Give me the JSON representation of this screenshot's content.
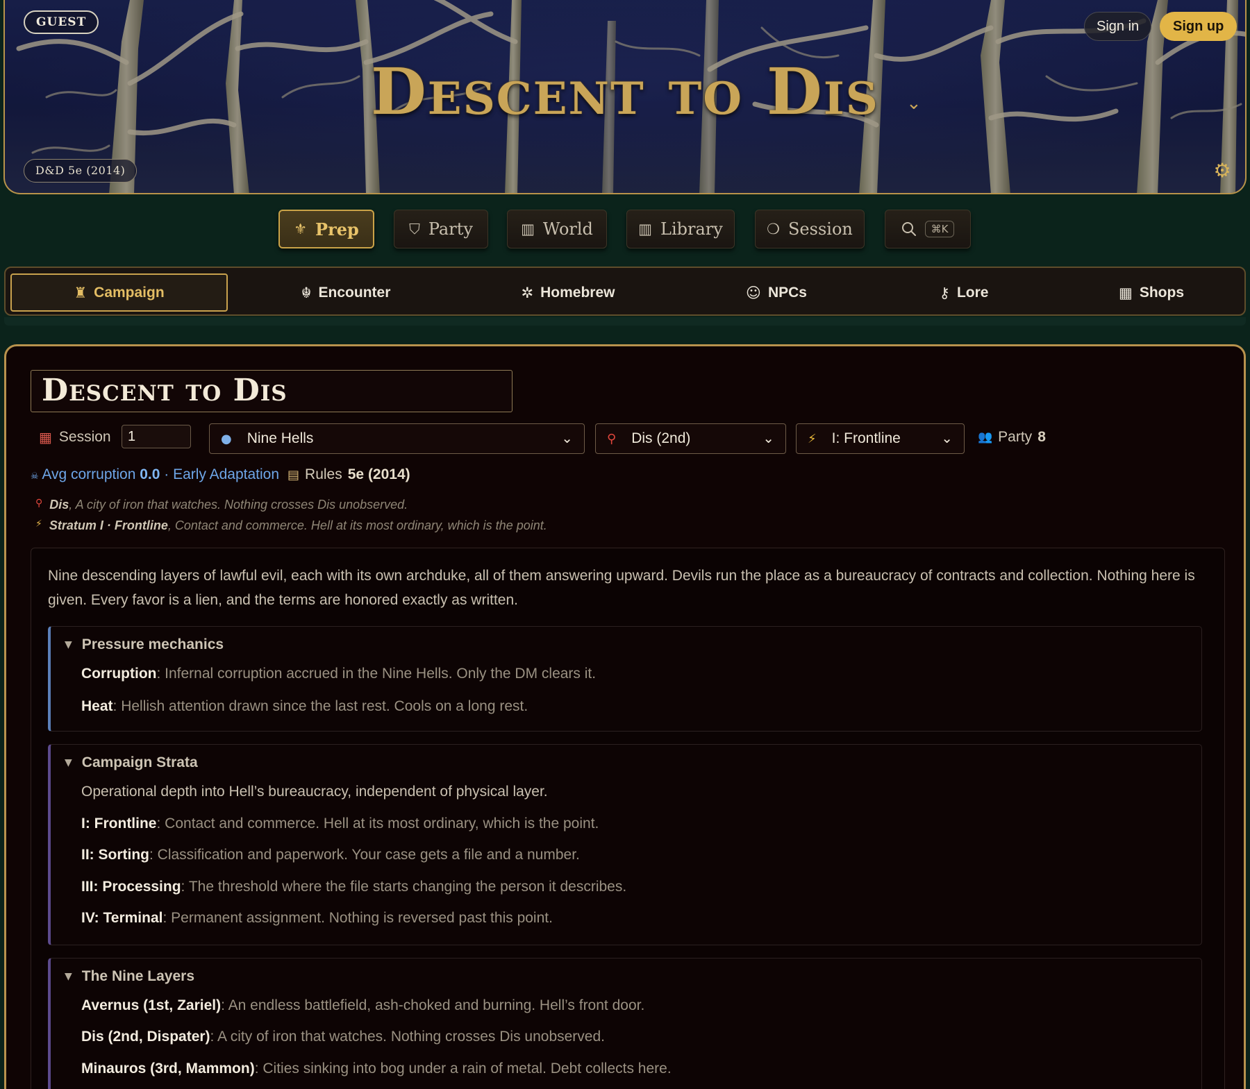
{
  "hero": {
    "guest_label": "GUEST",
    "title": "Descent to Dis",
    "system_label": "D&D 5e (2014)",
    "signin": "Sign in",
    "signup": "Sign up",
    "accent_color": "#c9a558"
  },
  "topnav": {
    "items": [
      {
        "label": "Prep",
        "icon": "helmet-icon",
        "active": true
      },
      {
        "label": "Party",
        "icon": "shield-icon"
      },
      {
        "label": "World",
        "icon": "book-icon"
      },
      {
        "label": "Library",
        "icon": "book-icon"
      },
      {
        "label": "Session",
        "icon": "chat-icon"
      }
    ],
    "search_shortcut": "⌘K"
  },
  "subnav": {
    "items": [
      {
        "label": "Campaign",
        "icon": "castle-icon",
        "active": true
      },
      {
        "label": "Encounter",
        "icon": "demon-icon"
      },
      {
        "label": "Homebrew",
        "icon": "gear-icon"
      },
      {
        "label": "NPCs",
        "icon": "masks-icon"
      },
      {
        "label": "Lore",
        "icon": "key-icon"
      },
      {
        "label": "Shops",
        "icon": "shop-icon"
      }
    ]
  },
  "campaign": {
    "title": "Descent to Dis",
    "session_label": "Session",
    "session_value": "1",
    "plane": "Nine Hells",
    "layer": "Dis (2nd)",
    "stratum": "I: Frontline",
    "party_label": "Party",
    "party_count": "8",
    "avg_corruption_label": "Avg corruption",
    "avg_corruption_value": "0.0",
    "adaptation": "· Early Adaptation",
    "rules_label": "Rules",
    "rules_value": "5e (2014)",
    "location_name": "Dis",
    "location_desc": ", A city of iron that watches. Nothing crosses Dis unobserved.",
    "stratum_name": "Stratum I · Frontline",
    "stratum_desc": ", Contact and commerce. Hell at its most ordinary, which is the point.",
    "intro": "Nine descending layers of lawful evil, each with its own archduke, all of them answering upward. Devils run the place as a bureaucracy of contracts and collection. Nothing here is given. Every favor is a lien, and the terms are honored exactly as written."
  },
  "sections": {
    "pressure": {
      "title": "Pressure mechanics",
      "lines": [
        {
          "term": "Corruption",
          "desc": ": Infernal corruption accrued in the Nine Hells. Only the DM clears it."
        },
        {
          "term": "Heat",
          "desc": ": Hellish attention drawn since the last rest. Cools on a long rest."
        }
      ]
    },
    "strata": {
      "title": "Campaign Strata",
      "intro": "Operational depth into Hell’s bureaucracy, independent of physical layer.",
      "lines": [
        {
          "term": "I: Frontline",
          "desc": ": Contact and commerce. Hell at its most ordinary, which is the point."
        },
        {
          "term": "II: Sorting",
          "desc": ": Classification and paperwork. Your case gets a file and a number."
        },
        {
          "term": "III: Processing",
          "desc": ": The threshold where the file starts changing the person it describes."
        },
        {
          "term": "IV: Terminal",
          "desc": ": Permanent assignment. Nothing is reversed past this point."
        }
      ]
    },
    "layers": {
      "title": "The Nine Layers",
      "lines": [
        {
          "term": "Avernus (1st, Zariel)",
          "desc": ": An endless battlefield, ash-choked and burning. Hell’s front door."
        },
        {
          "term": "Dis (2nd, Dispater)",
          "desc": ": A city of iron that watches. Nothing crosses Dis unobserved."
        },
        {
          "term": "Minauros (3rd, Mammon)",
          "desc": ": Cities sinking into bog under a rain of metal. Debt collects here."
        }
      ]
    }
  }
}
